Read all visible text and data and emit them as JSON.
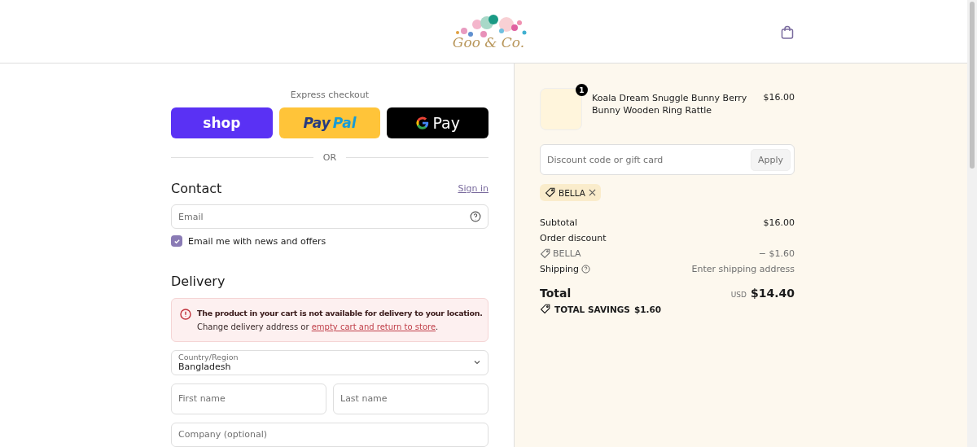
{
  "header": {
    "logo_text": "Goo & Co."
  },
  "express": {
    "title": "Express checkout",
    "buttons": [
      {
        "kind": "shop",
        "label": "shop"
      },
      {
        "kind": "paypal",
        "label_parts": [
          "Pay",
          "Pal"
        ]
      },
      {
        "kind": "gpay",
        "label": "Pay"
      }
    ],
    "divider": "OR"
  },
  "contact": {
    "title": "Contact",
    "sign_in": "Sign in",
    "email": {
      "placeholder": "Email"
    },
    "newsletter": {
      "label": "Email me with news and offers",
      "checked": true
    }
  },
  "delivery": {
    "title": "Delivery",
    "alert": {
      "message": "The product in your cart is not available for delivery to your location.",
      "detail": "Change delivery address or",
      "link": "empty cart and return to store",
      "end": "."
    },
    "country": {
      "label": "Country/Region",
      "value": "Bangladesh"
    },
    "first_name": {
      "placeholder": "First name"
    },
    "last_name": {
      "placeholder": "Last name"
    },
    "company": {
      "placeholder": "Company (optional)"
    }
  },
  "summary": {
    "item": {
      "name": "Koala Dream Snuggle Bunny Berry Bunny Wooden Ring Rattle",
      "quantity": "1",
      "price": "$16.00"
    },
    "discount": {
      "placeholder": "Discount code or gift card",
      "apply": "Apply",
      "applied_code": "BELLA"
    },
    "lines": [
      {
        "kind": "plain",
        "label": "Subtotal",
        "value": "$16.00"
      },
      {
        "kind": "heading",
        "label": "Order discount"
      },
      {
        "kind": "code",
        "label": "BELLA",
        "value": "− $1.60"
      },
      {
        "kind": "help",
        "label": "Shipping",
        "value": "Enter shipping address"
      }
    ],
    "total": {
      "label": "Total",
      "currency": "USD",
      "value": "$14.40"
    },
    "savings": {
      "label": "TOTAL SAVINGS",
      "value": "$1.60"
    }
  }
}
